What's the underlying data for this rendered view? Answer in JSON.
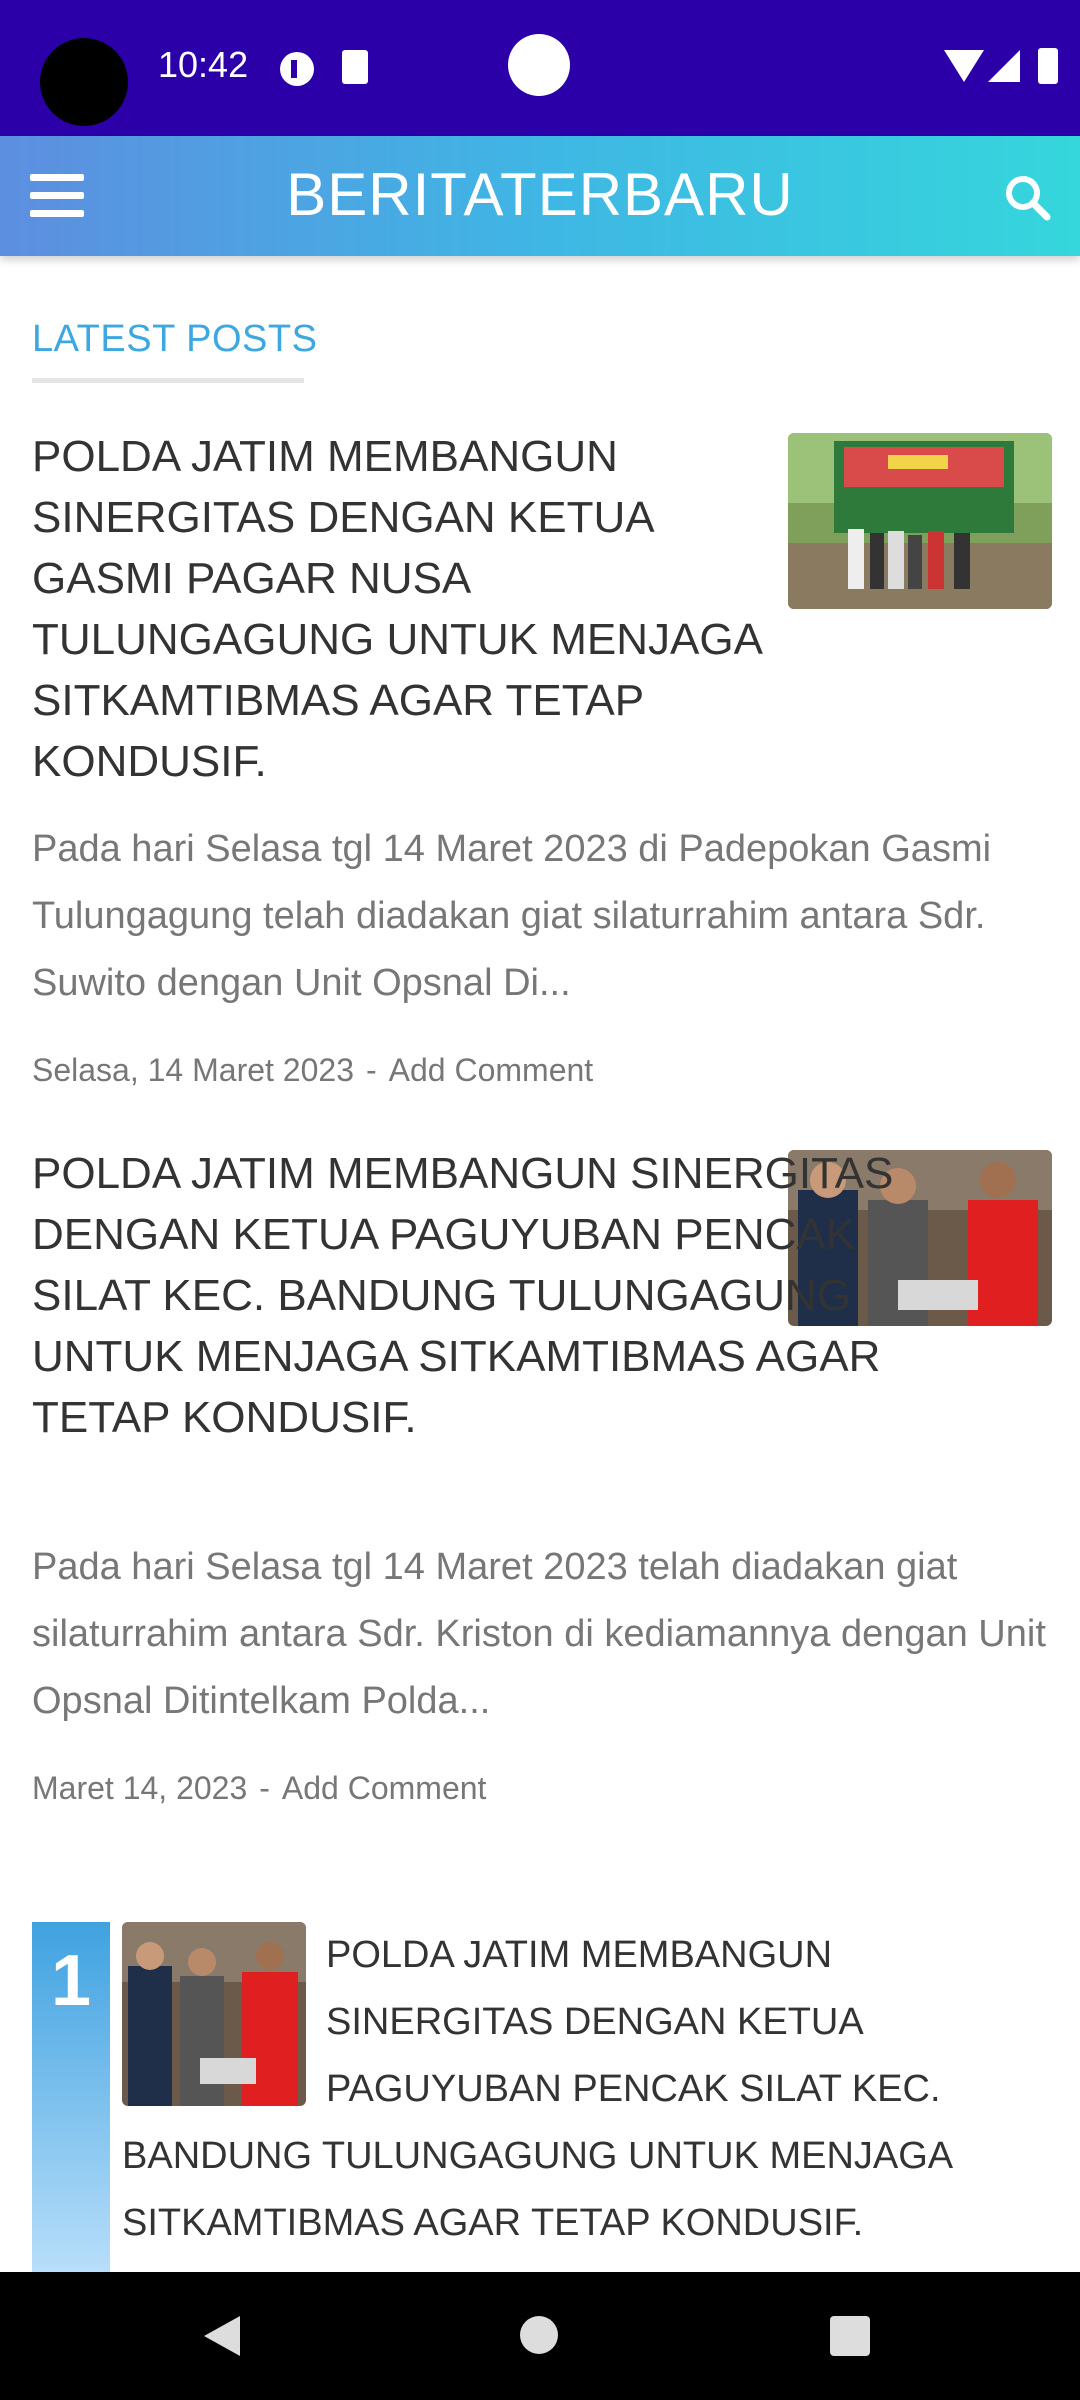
{
  "status_bar": {
    "time": "10:42"
  },
  "app_bar": {
    "title": "BERITATERBARU"
  },
  "section": {
    "header": "LATEST POSTS"
  },
  "posts": [
    {
      "title": "POLDA JATIM MEMBANGUN SINERGITAS DENGAN KETUA GASMI PAGAR NUSA TULUNGAGUNG UNTUK MENJAGA SITKAMTIBMAS AGAR TETAP KONDUSIF.",
      "excerpt": " Pada hari Selasa tgl 14 Maret 2023 di Padepokan Gasmi Tulungagung telah diadakan giat silaturrahim antara Sdr. Suwito dengan Unit Opsnal Di...",
      "date": "Selasa, 14 Maret 2023",
      "comment": "Add Comment"
    },
    {
      "title": "POLDA JATIM MEMBANGUN SINERGITAS DENGAN KETUA PAGUYUBAN PENCAK SILAT KEC. BANDUNG TULUNGAGUNG UNTUK MENJAGA SITKAMTIBMAS AGAR TETAP KONDUSIF.",
      "excerpt": "Pada hari Selasa tgl 14 Maret 2023 telah diadakan giat silaturrahim antara Sdr. Kriston di kediamannya dengan Unit Opsnal Ditintelkam Polda...",
      "date": "Maret 14, 2023",
      "comment": "Add Comment"
    }
  ],
  "popular": [
    {
      "rank": "1",
      "title": "POLDA JATIM MEMBANGUN SINERGITAS DENGAN KETUA PAGUYUBAN PENCAK SILAT KEC. BANDUNG TULUNGAGUNG UNTUK MENJAGA SITKAMTIBMAS AGAR TETAP KONDUSIF."
    }
  ],
  "colors": {
    "status_bar": "#2b00a8",
    "accent": "#3da7e0",
    "title_text": "#333333",
    "meta_text": "#777777"
  },
  "icons": [
    "menu-icon",
    "search-icon",
    "back-icon",
    "home-icon",
    "recents-icon"
  ]
}
